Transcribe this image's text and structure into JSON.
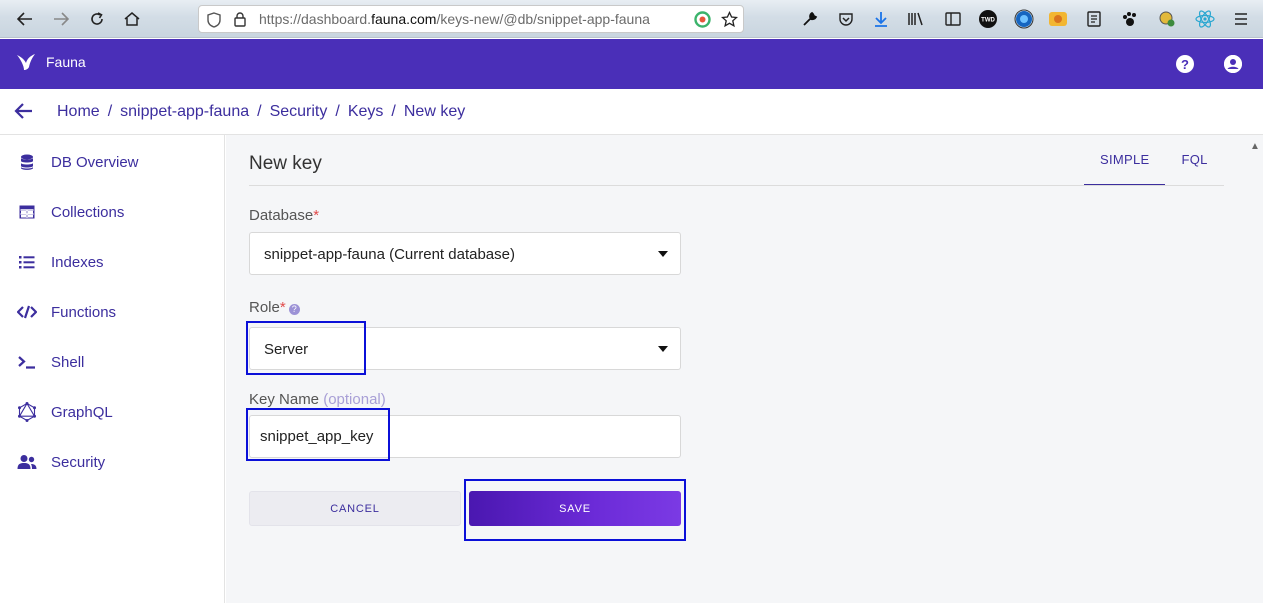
{
  "browser": {
    "url_prefix": "https://dashboard.",
    "url_domain": "fauna.com",
    "url_path": "/keys-new/@db/snippet-app-fauna",
    "nav_icons": [
      "back-arrow-icon",
      "forward-arrow-icon",
      "reload-icon",
      "home-icon"
    ],
    "toolbar_icons": [
      "wrench-icon",
      "pocket-icon",
      "download-icon",
      "library-icon",
      "reader-icon",
      "twd-extension-icon",
      "globe-extension-icon",
      "firefox-extension-icon",
      "notes-extension-icon",
      "paw-extension-icon",
      "gear-extension-icon",
      "react-extension-icon",
      "menu-icon"
    ],
    "twd_label": "TWD"
  },
  "header": {
    "brand": "Fauna",
    "help_icon": "?",
    "account_icon": "user-icon",
    "color": "#4a2fb8"
  },
  "breadcrumb": {
    "items": [
      "Home",
      "snippet-app-fauna",
      "Security",
      "Keys",
      "New key"
    ],
    "separator": "/"
  },
  "sidebar": {
    "items": [
      {
        "label": "DB Overview",
        "icon": "database-icon"
      },
      {
        "label": "Collections",
        "icon": "table-icon"
      },
      {
        "label": "Indexes",
        "icon": "list-icon"
      },
      {
        "label": "Functions",
        "icon": "code-icon"
      },
      {
        "label": "Shell",
        "icon": "terminal-icon"
      },
      {
        "label": "GraphQL",
        "icon": "graphql-icon"
      },
      {
        "label": "Security",
        "icon": "users-icon"
      }
    ]
  },
  "main": {
    "title": "New key",
    "tabs": [
      {
        "label": "SIMPLE",
        "active": true
      },
      {
        "label": "FQL",
        "active": false
      }
    ],
    "form": {
      "database_label": "Database",
      "database_value": "snippet-app-fauna (Current database)",
      "role_label": "Role",
      "role_help": "?",
      "role_value": "Server",
      "key_name_label": "Key Name",
      "key_name_optional": "(optional)",
      "key_name_value": "snippet_app_key",
      "required_mark": "*"
    },
    "buttons": {
      "cancel": "CANCEL",
      "save": "SAVE"
    }
  },
  "colors": {
    "accent": "#3c2e9e",
    "highlight": "#0b10d8",
    "save_start": "#4a17b0",
    "save_end": "#7b3ae4"
  }
}
